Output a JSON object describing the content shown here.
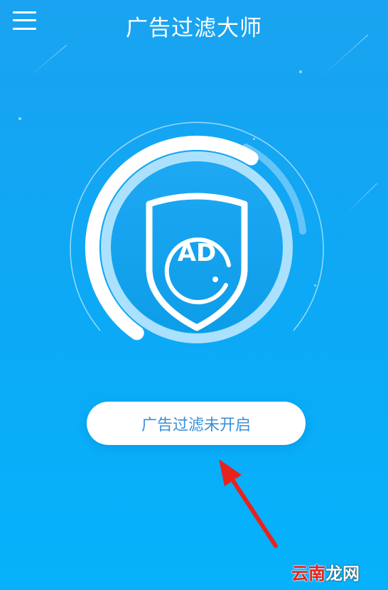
{
  "header": {
    "title": "广告过滤大师",
    "menu_icon": "menu-icon"
  },
  "gauge": {
    "badge_text": "AD",
    "shield_icon": "shield-icon",
    "progress_fraction": 0.7
  },
  "main": {
    "toggle_label": "广告过滤未开启"
  },
  "annotation": {
    "arrow_icon": "red-arrow-icon",
    "arrow_color": "#e8231c"
  },
  "watermark": {
    "part1": "云南",
    "part2": "龙网"
  },
  "colors": {
    "background_top": "#1aa3f0",
    "background_bottom": "#05b2fb",
    "button_text": "#3a8fd8"
  }
}
